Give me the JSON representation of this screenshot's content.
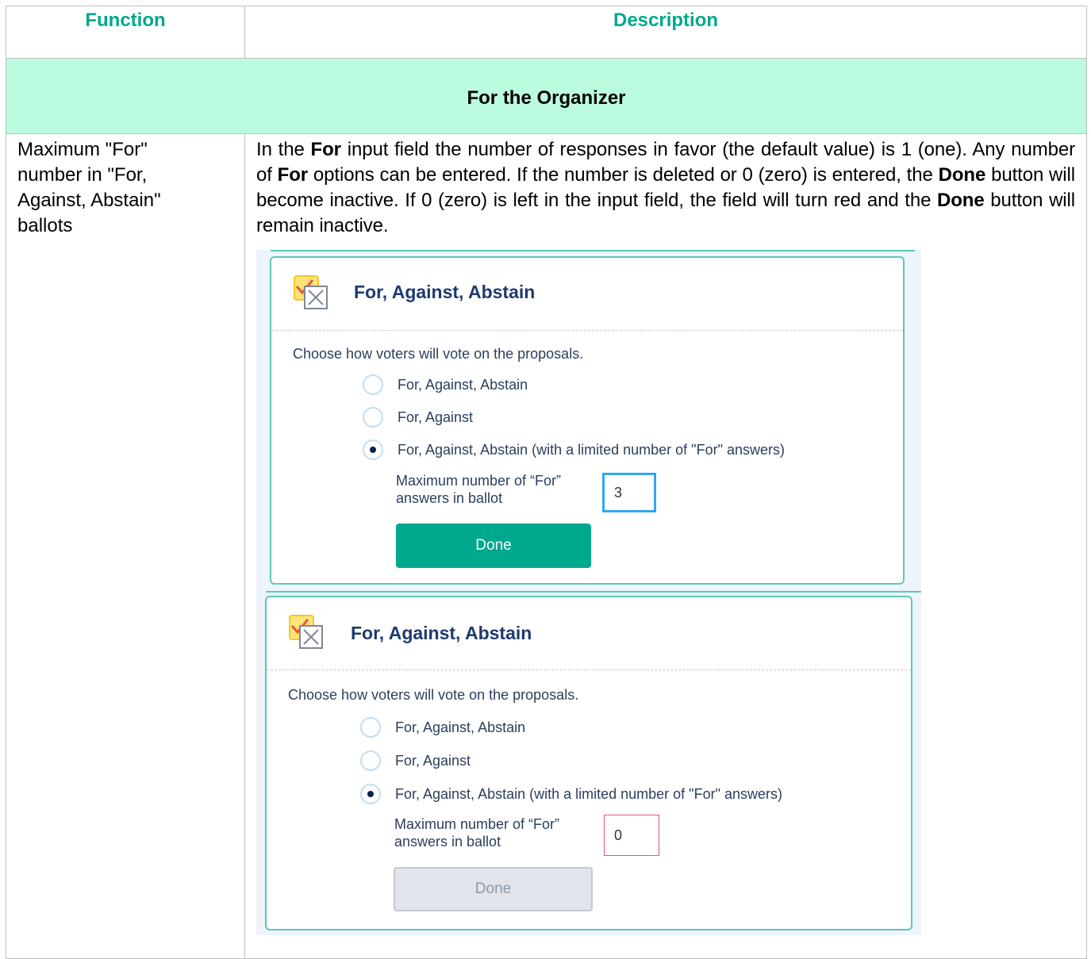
{
  "header": {
    "function": "Function",
    "description": "Description"
  },
  "section": {
    "title": "For the Organizer"
  },
  "row": {
    "function_text": "Maximum \"For\" number in \"For, Against, Abstain\" ballots",
    "description": {
      "p1": "In the ",
      "b1": "For",
      "p2": " input field the number of responses in favor (the default value) is 1 (one). Any number of ",
      "b2": "For",
      "p3": " options can be entered. If the number is deleted or 0 (zero) is entered, the ",
      "b3": "Done",
      "p4": " button will become inactive. If 0 (zero) is left in the input field, the field will turn red and the ",
      "b4": "Done",
      "p5": " button will remain inactive."
    }
  },
  "panels": [
    {
      "title": "For, Against, Abstain",
      "choose_text": "Choose how voters will vote on the proposals.",
      "options": [
        {
          "label": "For, Against, Abstain",
          "selected": false
        },
        {
          "label": "For, Against",
          "selected": false
        },
        {
          "label": "For, Against, Abstain (with a limited number of \"For\" answers)",
          "selected": true
        }
      ],
      "max_label_line1": "Maximum number of “For”",
      "max_label_line2": "answers in ballot",
      "input_value": "3",
      "done_label": "Done",
      "done_state": "active"
    },
    {
      "title": "For, Against, Abstain",
      "choose_text": "Choose how voters will vote on the proposals.",
      "options": [
        {
          "label": "For, Against, Abstain",
          "selected": false
        },
        {
          "label": "For, Against",
          "selected": false
        },
        {
          "label": "For, Against, Abstain (with a limited number of \"For\" answers)",
          "selected": true
        }
      ],
      "max_label_line1": "Maximum number of “For”",
      "max_label_line2": "answers in ballot",
      "input_value": "0",
      "done_label": "Done",
      "done_state": "inactive"
    }
  ],
  "colors": {
    "header_text": "#00a88e",
    "section_bg": "#bbfbe0",
    "card_border": "#5ec8b4",
    "done_active": "#00a88e",
    "input_focus": "#2fa8ec",
    "input_error": "#e8507a"
  }
}
